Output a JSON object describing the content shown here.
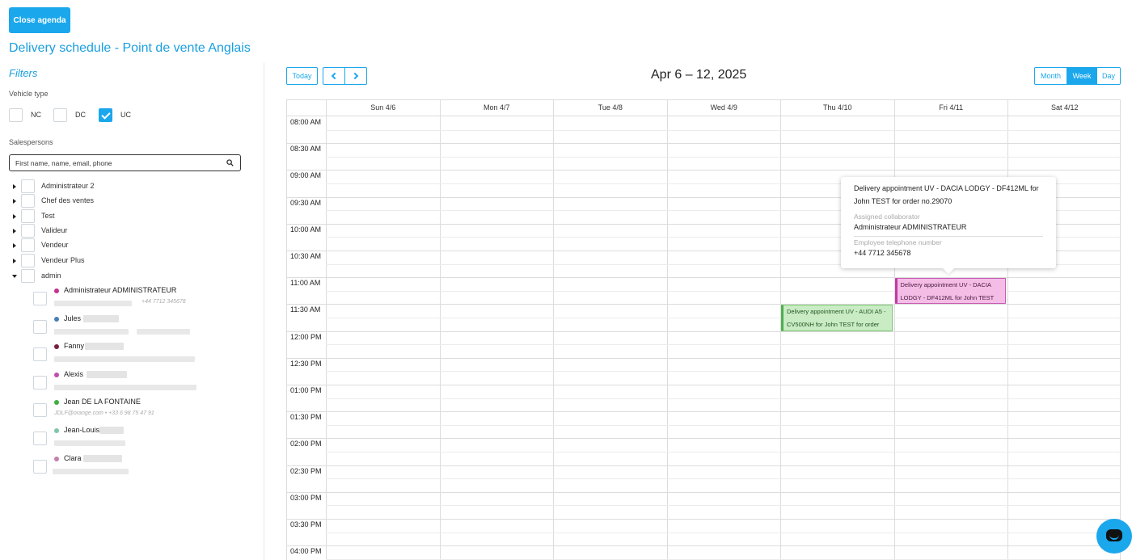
{
  "header": {
    "close_label": "Close agenda",
    "page_title": "Delivery schedule - Point de vente Anglais"
  },
  "filters": {
    "title": "Filters",
    "vehicle_type_label": "Vehicle type",
    "vehicle_types": [
      {
        "label": "NC",
        "checked": false
      },
      {
        "label": "DC",
        "checked": false
      },
      {
        "label": "UC",
        "checked": true
      }
    ],
    "salespersons_label": "Salespersons",
    "search_placeholder": "First name, name, email, phone",
    "groups": [
      {
        "label": "Administrateur 2",
        "expanded": false
      },
      {
        "label": "Chef des ventes",
        "expanded": false
      },
      {
        "label": "Test",
        "expanded": false
      },
      {
        "label": "Valideur",
        "expanded": false
      },
      {
        "label": "Vendeur",
        "expanded": false
      },
      {
        "label": "Vendeur Plus",
        "expanded": false
      },
      {
        "label": "admin",
        "expanded": true
      }
    ],
    "persons": [
      {
        "name": "Administrateur ADMINISTRATEUR",
        "color": "#c2338f",
        "contact": "+44 7712 345678"
      },
      {
        "name": "Jules",
        "color": "#4a7fb5",
        "contact": ""
      },
      {
        "name": "Fanny",
        "color": "#7a1f3d",
        "contact": ""
      },
      {
        "name": "Alexis",
        "color": "#c24ca8",
        "contact": ""
      },
      {
        "name": "Jean DE LA FONTAINE",
        "color": "#3fae3f",
        "contact": "JDLF@orange.com  •  +33 6 98 75 47 91"
      },
      {
        "name": "Jean-Louis",
        "color": "#7fc5a8",
        "contact": ""
      },
      {
        "name": "Clara",
        "color": "#c57fae",
        "contact": ""
      }
    ]
  },
  "calendar": {
    "today_label": "Today",
    "date_range": "Apr 6 – 12, 2025",
    "view_month": "Month",
    "view_week": "Week",
    "view_day": "Day",
    "active_view": "Week",
    "days": [
      "Sun 4/6",
      "Mon 4/7",
      "Tue 4/8",
      "Wed 4/9",
      "Thu 4/10",
      "Fri 4/11",
      "Sat 4/12"
    ],
    "times": [
      "08:00 AM",
      "08:30 AM",
      "09:00 AM",
      "09:30 AM",
      "10:00 AM",
      "10:30 AM",
      "11:00 AM",
      "11:30 AM",
      "12:00 PM",
      "12:30 PM",
      "01:00 PM",
      "01:30 PM",
      "02:00 PM",
      "02:30 PM",
      "03:00 PM",
      "03:30 PM",
      "04:00 PM"
    ],
    "events": [
      {
        "text": "Delivery appointment UV - AUDI A5 - CV500NH for John TEST for order",
        "day": "Thu 4/10",
        "start": "11:30 AM",
        "end": "12:00 PM",
        "color": "#c9ecc4"
      },
      {
        "text": "Delivery appointment UV - DACIA LODGY - DF412ML for John TEST",
        "day": "Fri 4/11",
        "start": "11:00 AM",
        "end": "11:30 AM",
        "color": "#f3bde5"
      }
    ],
    "tooltip": {
      "title": "Delivery appointment UV - DACIA LODGY - DF412ML for John TEST for order no.29070",
      "collaborator_label": "Assigned collaborator",
      "collaborator_value": "Administrateur ADMINISTRATEUR",
      "phone_label": "Employee telephone number",
      "phone_value": "+44 7712 345678"
    }
  }
}
